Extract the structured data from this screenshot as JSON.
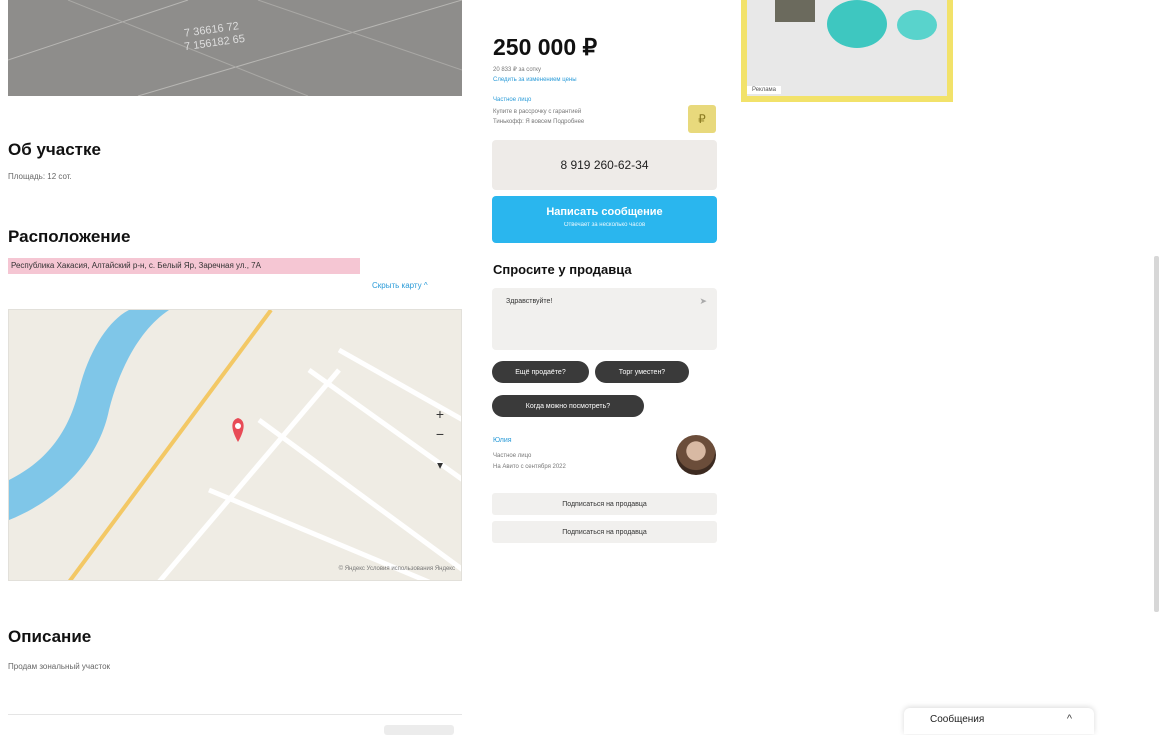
{
  "colors": {
    "accent_blue": "#2ab6ee",
    "link_blue": "#2a9bd8",
    "address_highlight": "#f5c6d3",
    "chip_dark": "#3a3a3a",
    "ad_yellow": "#f2e26a",
    "map_bg": "#efece4"
  },
  "photo": {
    "label_line1": "7 36616 72",
    "label_line2": "7 156182 65"
  },
  "about": {
    "title": "Об участке",
    "area_label": "Площадь: 12 сот."
  },
  "location": {
    "title": "Расположение",
    "address": "Республика Хакасия, Алтайский р-н, с. Белый Яр, Заречная ул., 7А",
    "show_map_label": "Скрыть карту ^"
  },
  "map": {
    "zoom_in": "+",
    "zoom_out": "−",
    "locate": "▲",
    "copyright": "© Яндекс  Условия использования  Яндекс",
    "pin_icon": "map-pin-icon"
  },
  "description": {
    "title": "Описание",
    "text": "Продам зональный участок"
  },
  "offer": {
    "price": "250 000 ₽",
    "price_per_unit": "20 833 ₽ за сотку",
    "price_history": "Следить за изменением цены",
    "seller_type": "Частное лицо",
    "seller_note1": "Купите в рассрочку с гарантией",
    "seller_note2": "Тинькофф: Я вовсем  Подробнее",
    "phone_label": "8 919 260-62-34",
    "message_label": "Написать сообщение",
    "message_sub": "Отвечает за несколько часов"
  },
  "ask": {
    "title": "Спросите у продавца",
    "placeholder": "Здравствуйте!",
    "chips": [
      "Ещё продаёте?",
      "Торг уместен?",
      "Когда можно посмотреть?"
    ]
  },
  "seller": {
    "name": "Юлия",
    "type": "Частное лицо",
    "since": "На Авито с сентября 2022",
    "subscribe_label": "Подписаться на продавца",
    "contact_label": "Подписаться на продавца"
  },
  "ad": {
    "mark": "Реклама"
  },
  "messenger": {
    "label": "Сообщения"
  }
}
